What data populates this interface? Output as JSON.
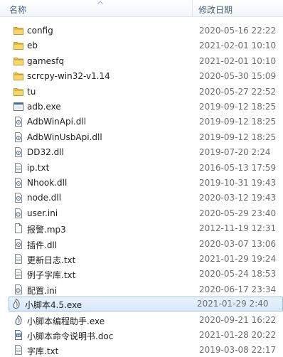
{
  "header": {
    "name_label": "名称",
    "date_label": "修改日期"
  },
  "files": [
    {
      "name": "config",
      "date": "2020-05-16 22:22",
      "icon": "folder-icon"
    },
    {
      "name": "eb",
      "date": "2021-02-01 10:10",
      "icon": "folder-icon"
    },
    {
      "name": "gamesfq",
      "date": "2021-02-01 10:10",
      "icon": "folder-icon"
    },
    {
      "name": "scrcpy-win32-v1.14",
      "date": "2020-05-30 15:09",
      "icon": "folder-icon"
    },
    {
      "name": "tu",
      "date": "2020-05-27 22:52",
      "icon": "folder-icon"
    },
    {
      "name": "adb.exe",
      "date": "2019-09-12 18:25",
      "icon": "exe-icon"
    },
    {
      "name": "AdbWinApi.dll",
      "date": "2019-09-12 18:25",
      "icon": "dll-icon"
    },
    {
      "name": "AdbWinUsbApi.dll",
      "date": "2019-09-12 18:25",
      "icon": "dll-icon"
    },
    {
      "name": "DD32.dll",
      "date": "2019-07-20 2:24",
      "icon": "dll-icon"
    },
    {
      "name": "ip.txt",
      "date": "2016-05-13 17:59",
      "icon": "txt-icon"
    },
    {
      "name": "Nhook.dll",
      "date": "2019-10-31 19:43",
      "icon": "dll-icon"
    },
    {
      "name": "node.dll",
      "date": "2020-03-12 19:43",
      "icon": "dll-icon"
    },
    {
      "name": "user.ini",
      "date": "2020-05-29 23:40",
      "icon": "ini-icon"
    },
    {
      "name": "报警.mp3",
      "date": "2012-11-19 12:31",
      "icon": "file-icon"
    },
    {
      "name": "插件.dll",
      "date": "2020-03-07 13:06",
      "icon": "dll-icon"
    },
    {
      "name": "更新日志.txt",
      "date": "2021-01-29 19:24",
      "icon": "txt-icon"
    },
    {
      "name": "例子字库.txt",
      "date": "2020-05-24 18:53",
      "icon": "txt-icon"
    },
    {
      "name": "配置.ini",
      "date": "2020-06-17 23:34",
      "icon": "ini-icon"
    },
    {
      "name": "小脚本4.5.exe",
      "date": "2021-01-29 2:40",
      "icon": "app-icon",
      "selected": true
    },
    {
      "name": "小脚本编程助手.exe",
      "date": "2020-09-21 16:22",
      "icon": "app-icon"
    },
    {
      "name": "小脚本命令说明书.doc",
      "date": "2021-01-28 20:22",
      "icon": "doc-icon"
    },
    {
      "name": "字库.txt",
      "date": "2019-03-08 22:17",
      "icon": "txt-icon"
    }
  ]
}
